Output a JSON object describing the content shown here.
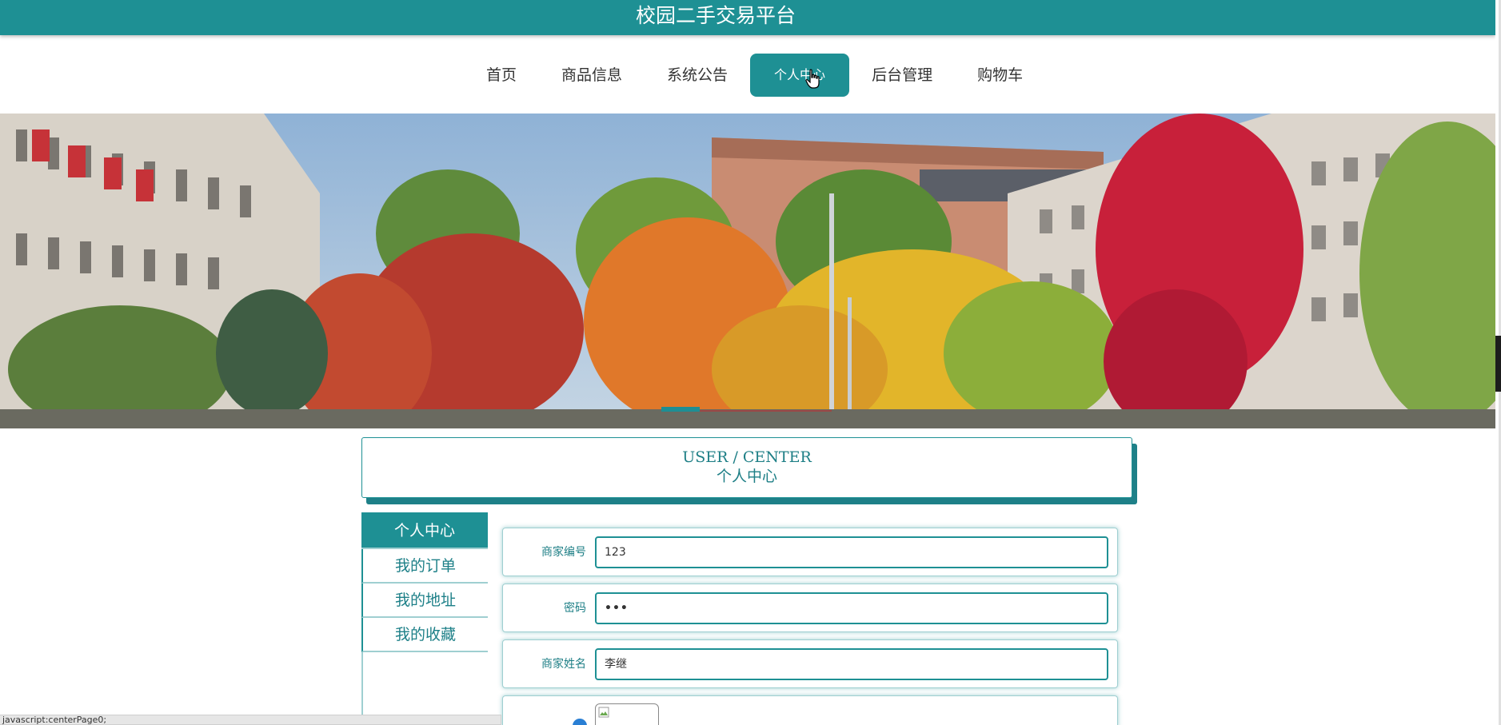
{
  "header": {
    "title": "校园二手交易平台"
  },
  "nav": {
    "items": [
      {
        "label": "首页"
      },
      {
        "label": "商品信息"
      },
      {
        "label": "系统公告"
      },
      {
        "label": "个人中心"
      },
      {
        "label": "后台管理"
      },
      {
        "label": "购物车"
      }
    ],
    "active_label": "个人中心"
  },
  "banner": {
    "active_slide": 1
  },
  "user_center": {
    "title_en": "USER / CENTER",
    "title_cn": "个人中心"
  },
  "sidebar": {
    "items": [
      {
        "label": "个人中心"
      },
      {
        "label": "我的订单"
      },
      {
        "label": "我的地址"
      },
      {
        "label": "我的收藏"
      }
    ]
  },
  "form": {
    "fields": [
      {
        "label": "商家编号",
        "value": "123"
      },
      {
        "label": "密码",
        "value": "•••"
      },
      {
        "label": "商家姓名",
        "value": "李继"
      }
    ]
  },
  "statusbar": {
    "text": "javascript:centerPage0;"
  },
  "colors": {
    "primary": "#1e9094",
    "text": "#1e7f86",
    "nav_text": "#333333"
  }
}
